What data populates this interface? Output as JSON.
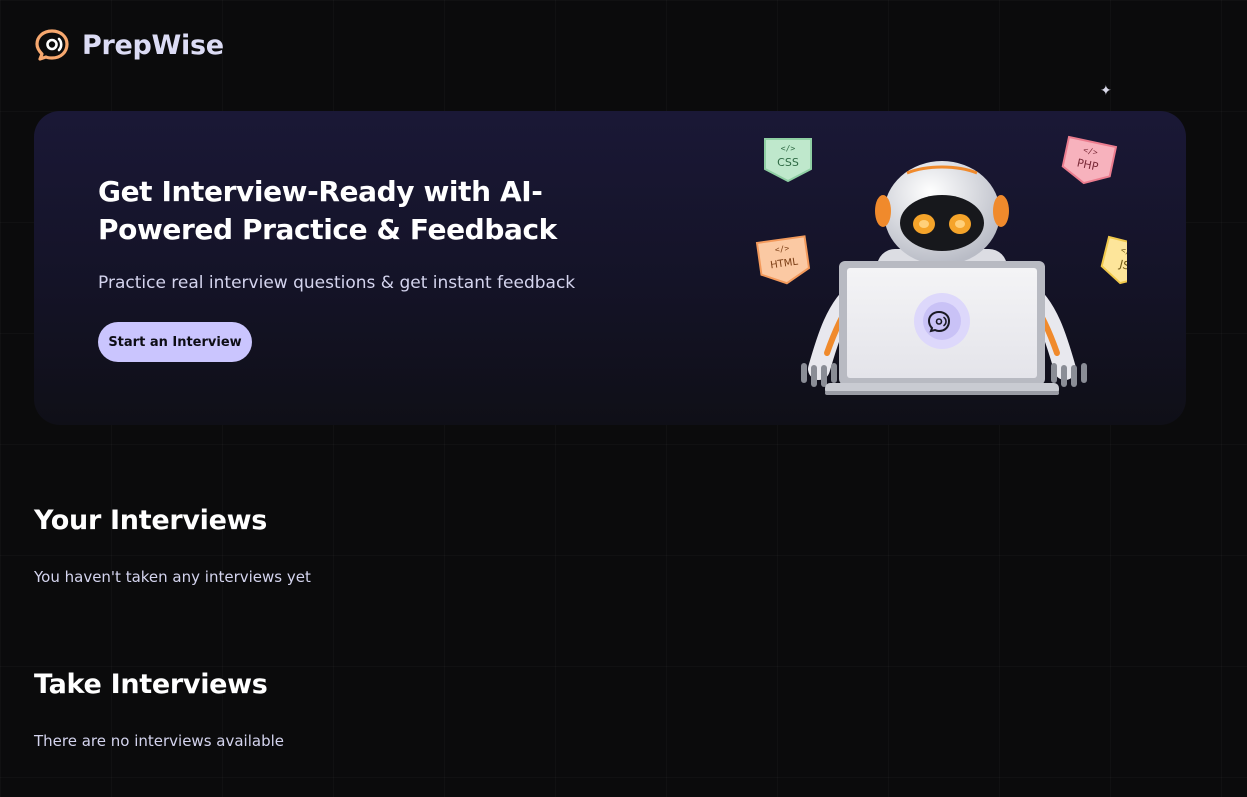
{
  "app": {
    "name": "PrepWise"
  },
  "hero": {
    "title": "Get Interview-Ready with AI-Powered Practice & Feedback",
    "subtitle": "Practice real interview questions & get instant feedback",
    "cta_label": "Start an Interview",
    "badges": {
      "css": "CSS",
      "php": "PHP",
      "html": "HTML",
      "js": "JS"
    }
  },
  "your_interviews": {
    "title": "Your Interviews",
    "empty_text": "You haven't taken any interviews yet"
  },
  "take_interviews": {
    "title": "Take Interviews",
    "empty_text": "There are no interviews available"
  },
  "colors": {
    "background": "#0b0b0c",
    "accent": "#cac5fe",
    "brand_text": "#dcdcf5",
    "body_text": "#d4d4ee",
    "logo_orange": "#f7a86f"
  }
}
